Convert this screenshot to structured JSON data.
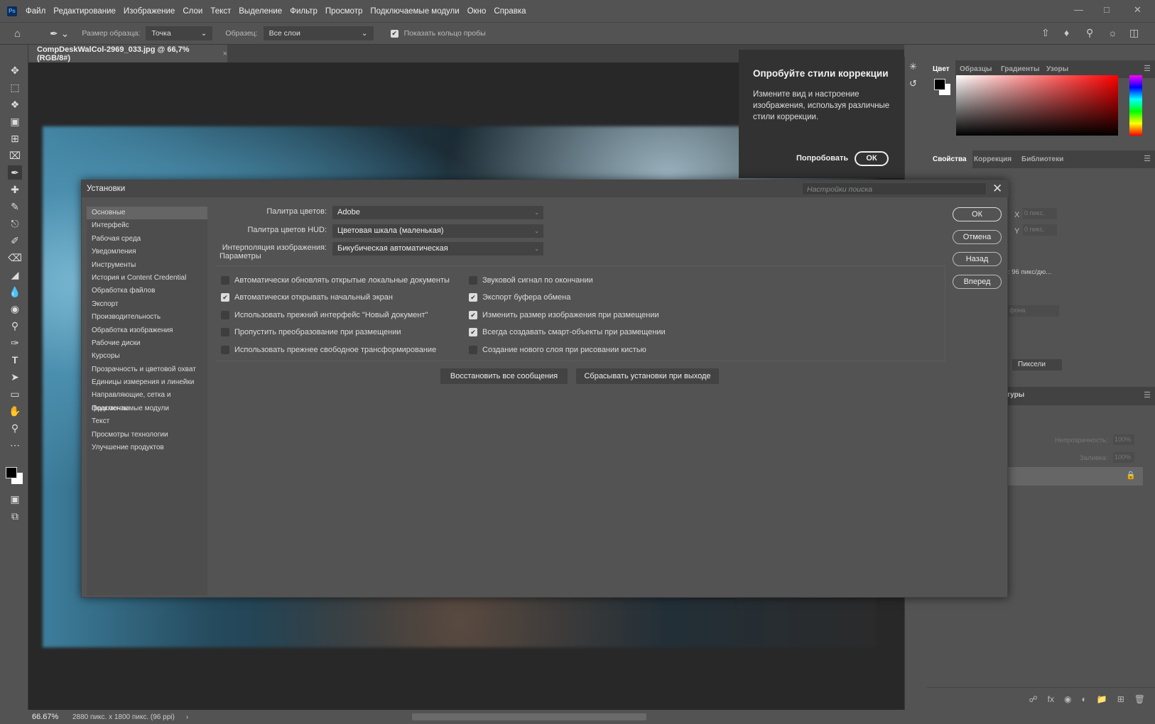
{
  "menu": {
    "logo": "Ps",
    "items": [
      "Файл",
      "Редактирование",
      "Изображение",
      "Слои",
      "Текст",
      "Выделение",
      "Фильтр",
      "Просмотр",
      "Подключаемые модули",
      "Окно",
      "Справка"
    ]
  },
  "options": {
    "sample_size_label": "Размер образца:",
    "sample_size": "Точка",
    "sample_label": "Образец:",
    "sample": "Все слои",
    "show_ring": "Показать кольцо пробы",
    "show_ring_checked": true
  },
  "document_tab": {
    "title": "CompDeskWalCol-2969_033.jpg @ 66,7% (RGB/8#)"
  },
  "popup": {
    "title": "Опробуйте стили коррекции",
    "body": "Измените вид и настроение изображения, используя различные стили коррекции.",
    "try": "Попробовать",
    "ok": "ОК"
  },
  "right_panel": {
    "color_tabs": [
      "Цвет",
      "Образцы",
      "Градиенты",
      "Узоры"
    ],
    "props_tabs": [
      "Свойства",
      "Коррекция",
      "Библиотеки"
    ],
    "x_label": "X",
    "y_label": "Y",
    "x_val": "0 пикс.",
    "y_val": "0 пикс.",
    "resolution": ": 96 пикс/дю...",
    "units": "Пиксели",
    "layers_tab": "туры",
    "opacity_label": "Непрозрачность:",
    "opacity": "100%",
    "fill_label": "Заливка:",
    "fill": "100%",
    "bg_label": "фона"
  },
  "dialog": {
    "title": "Установки",
    "search_placeholder": "Настройки поиска",
    "sidebar": [
      "Основные",
      "Интерфейс",
      "Рабочая среда",
      "Уведомления",
      "Инструменты",
      "История и Content Credential",
      "Обработка файлов",
      "Экспорт",
      "Производительность",
      "Обработка изображения",
      "Рабочие диски",
      "Курсоры",
      "Прозрачность и цветовой охват",
      "Единицы измерения и линейки",
      "Направляющие, сетка и фрагменты",
      "Подключаемые модули",
      "Текст",
      "Просмотры технологии",
      "Улучшение продуктов"
    ],
    "fields": [
      {
        "label": "Палитра цветов:",
        "value": "Adobe"
      },
      {
        "label": "Палитра цветов HUD:",
        "value": "Цветовая шкала (маленькая)"
      },
      {
        "label": "Интерполяция изображения:",
        "value": "Бикубическая автоматическая"
      }
    ],
    "group_label": "Параметры",
    "left_options": [
      {
        "label": "Автоматически обновлять открытые локальные документы",
        "checked": false
      },
      {
        "label": "Автоматически открывать начальный экран",
        "checked": true
      },
      {
        "label": "Использовать прежний интерфейс \"Новый документ\"",
        "checked": false
      },
      {
        "label": "Пропустить преобразование при размещении",
        "checked": false
      },
      {
        "label": "Использовать прежнее свободное трансформирование",
        "checked": false
      }
    ],
    "right_options": [
      {
        "label": "Звуковой сигнал по окончании",
        "checked": false
      },
      {
        "label": "Экспорт буфера обмена",
        "checked": true
      },
      {
        "label": "Изменить размер изображения при размещении",
        "checked": true
      },
      {
        "label": "Всегда создавать смарт-объекты при размещении",
        "checked": true
      },
      {
        "label": "Создание нового слоя при рисовании кистью",
        "checked": false
      }
    ],
    "restore_button": "Восстановить все сообщения",
    "reset_button": "Сбрасывать установки при выходе",
    "ok": "ОК",
    "cancel": "Отмена",
    "back": "Назад",
    "forward": "Вперед"
  },
  "status": {
    "zoom": "66.67%",
    "info": "2880 пикс. x 1800 пикс. (96 ppi)"
  }
}
